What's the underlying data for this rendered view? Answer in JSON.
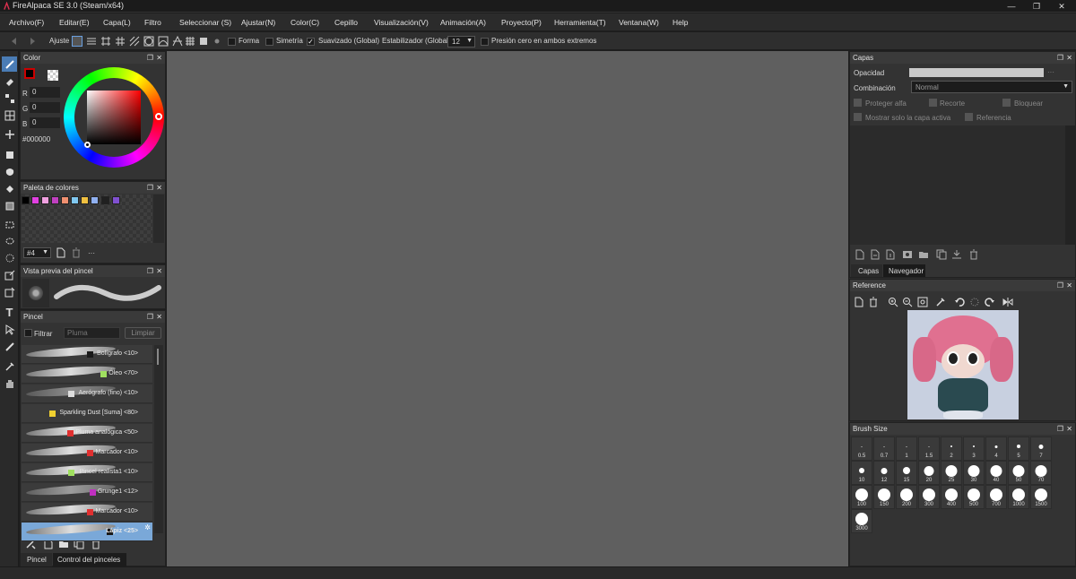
{
  "window": {
    "title": "FireAlpaca SE 3.0 (Steam/x64)",
    "minimize": "—",
    "maximize": "❐",
    "close": "✕"
  },
  "menu": [
    "Archivo(F)",
    "Editar(E)",
    "Capa(L)",
    "Filtro",
    "Seleccionar (S)",
    "Ajustar(N)",
    "Color(C)",
    "Cepillo",
    "Visualización(V)",
    "Animación(A)",
    "Proyecto(P)",
    "Herramienta(T)",
    "Ventana(W)",
    "Help"
  ],
  "toolbar": {
    "ajuste": "Ajuste",
    "forma": "Forma",
    "simetria": "Simetría",
    "suavizado": "Suavizado (Global)",
    "estabilizador": "Estabilizador (Global)",
    "estabilizador_value": "12",
    "presion": "Presión cero en ambos extremos"
  },
  "color_panel": {
    "title": "Color",
    "r_label": "R",
    "g_label": "G",
    "b_label": "B",
    "r": "0",
    "g": "0",
    "b": "0",
    "hex": "#000000"
  },
  "palette_panel": {
    "title": "Paleta de colores",
    "selector": "#4",
    "more": "···",
    "swatches": [
      "#000000",
      "#e040e0",
      "#f0a0e0",
      "#c040c0",
      "#f09070",
      "#80c8f0",
      "#f0c040",
      "#90b0f0",
      "#202020",
      "#8050d0"
    ]
  },
  "brush_preview_panel": {
    "title": "Vista previa del pincel"
  },
  "brush_panel": {
    "title": "Pincel",
    "filter_label": "Filtrar",
    "filter_placeholder": "Pluma",
    "clear": "Limpiar",
    "brushes": [
      {
        "name": "Bolígrafo <10>",
        "color": "#1a1a1a"
      },
      {
        "name": "Óleo <70>",
        "color": "#a0e060"
      },
      {
        "name": "Aerógrafo (fino) <10>",
        "color": "#dddddd"
      },
      {
        "name": "Sparkling Dust [Suma] <80>",
        "color": "#f0d030"
      },
      {
        "name": "Pluma analógica <50>",
        "color": "#e03030"
      },
      {
        "name": "Marcador <10>",
        "color": "#e03030"
      },
      {
        "name": "Pincel realista1 <10>",
        "color": "#a0e060"
      },
      {
        "name": "Grunge1 <12>",
        "color": "#c030c0"
      },
      {
        "name": "Marcador <10>",
        "color": "#e03030"
      },
      {
        "name": "Lápiz <25>",
        "color": "#1a1a1a"
      }
    ],
    "tabs": [
      "Pincel",
      "Control del pinceles"
    ]
  },
  "layers_panel": {
    "title": "Capas",
    "opacity_label": "Opacidad",
    "blend_label": "Combinación",
    "blend_value": "Normal",
    "protect_alpha": "Proteger alfa",
    "clip": "Recorte",
    "lock": "Bloquear",
    "show_active": "Mostrar solo la capa activa",
    "reference": "Referencia",
    "tabs": [
      "Capas",
      "Navegador"
    ],
    "opacity_more": "···"
  },
  "reference_panel": {
    "title": "Reference"
  },
  "brush_size_panel": {
    "title": "Brush Size",
    "sizes": [
      "0.5",
      "0.7",
      "1",
      "1.5",
      "2",
      "3",
      "4",
      "5",
      "7",
      "10",
      "12",
      "15",
      "20",
      "25",
      "30",
      "40",
      "50",
      "70",
      "100",
      "150",
      "200",
      "300",
      "400",
      "500",
      "700",
      "1000",
      "1500",
      "3000"
    ]
  },
  "colors": {
    "accent": "#4a7cb5",
    "canvas": "#5f5f5f",
    "panel": "#333333"
  }
}
